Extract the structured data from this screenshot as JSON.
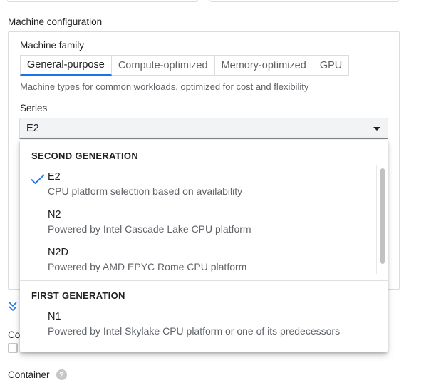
{
  "machine_configuration": {
    "title": "Machine configuration",
    "family_label": "Machine family",
    "tabs": [
      {
        "label": "General-purpose",
        "active": true
      },
      {
        "label": "Compute-optimized",
        "active": false
      },
      {
        "label": "Memory-optimized",
        "active": false
      },
      {
        "label": "GPU",
        "active": false
      }
    ],
    "family_description": "Machine types for common workloads, optimized for cost and flexibility",
    "series_label": "Series",
    "series_selected": "E2"
  },
  "series_dropdown": {
    "groups": [
      {
        "header": "SECOND GENERATION",
        "options": [
          {
            "name": "E2",
            "description": "CPU platform selection based on availability",
            "selected": true
          },
          {
            "name": "N2",
            "description": "Powered by Intel Cascade Lake CPU platform",
            "selected": false
          },
          {
            "name": "N2D",
            "description": "Powered by AMD EPYC Rome CPU platform",
            "selected": false
          }
        ]
      },
      {
        "header": "FIRST GENERATION",
        "options": [
          {
            "name": "N1",
            "description": "Powered by Intel Skylake CPU platform or one of its predecessors",
            "selected": false
          }
        ]
      }
    ]
  },
  "below": {
    "partial_label": "Co",
    "container_label": "Container",
    "help_glyph": "?"
  },
  "icons": {
    "check": "check-icon",
    "caret": "caret-down-icon",
    "expand": "double-chevron-down-icon",
    "help": "help-icon"
  },
  "colors": {
    "accent": "#1a73e8",
    "text_primary": "#202124",
    "text_secondary": "#5f6368",
    "border": "#dadce0"
  }
}
